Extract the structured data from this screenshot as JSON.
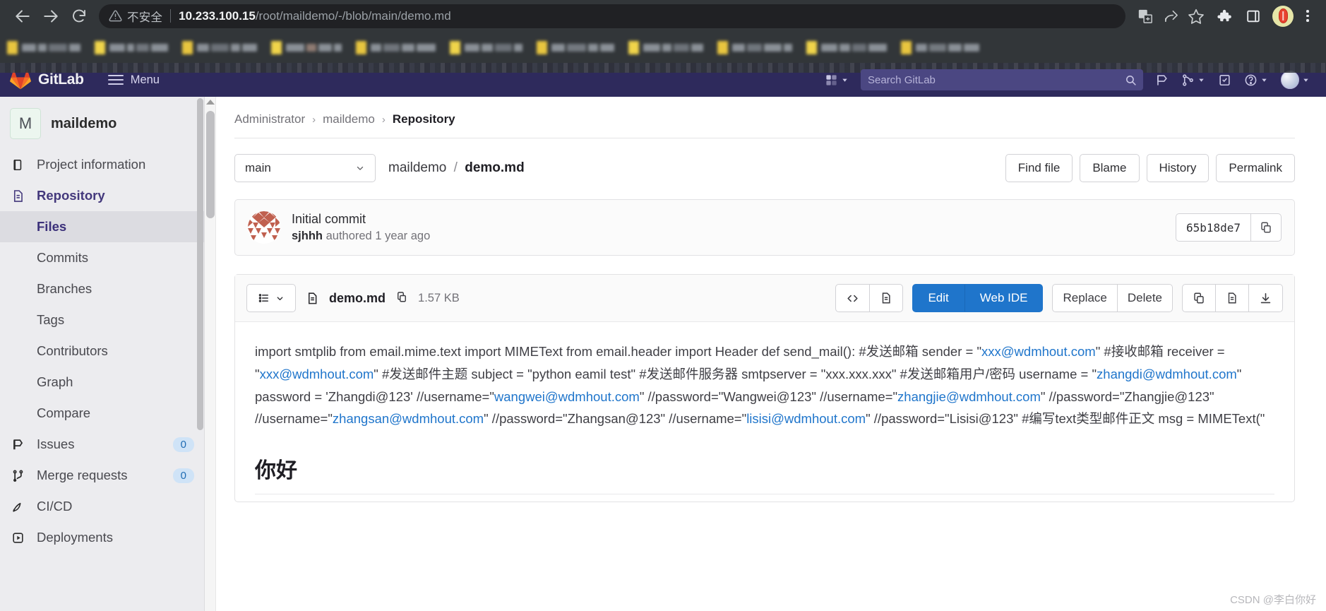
{
  "browser": {
    "back_icon": "back-arrow-icon",
    "forward_icon": "forward-arrow-icon",
    "reload_icon": "reload-icon",
    "security_label": "不安全",
    "url_bold": "10.233.100.15",
    "url_rest": "/root/maildemo/-/blob/main/demo.md",
    "translate_icon": "translate-icon",
    "share_icon": "share-icon",
    "bookmark_icon": "star-icon",
    "extensions_icon": "puzzle-icon",
    "sidepanel_icon": "side-panel-icon",
    "profile_icon": "profile-avatar-icon",
    "menu_icon": "three-dot-menu-icon"
  },
  "gitlab_nav": {
    "wordmark": "GitLab",
    "menu_label": "Menu",
    "search_placeholder": "Search GitLab",
    "icons": [
      "create-new-icon",
      "chevron-down-icon",
      "issues-icon",
      "merge-requests-icon",
      "todos-icon",
      "help-icon",
      "user-avatar-icon"
    ]
  },
  "sidebar": {
    "project_initial": "M",
    "project_name": "maildemo",
    "items": [
      {
        "label": "Project information",
        "icon": "project-info-icon",
        "active": false
      },
      {
        "label": "Repository",
        "icon": "repository-icon",
        "active": true
      }
    ],
    "sub_items": [
      {
        "label": "Files",
        "current": true
      },
      {
        "label": "Commits",
        "current": false
      },
      {
        "label": "Branches",
        "current": false
      },
      {
        "label": "Tags",
        "current": false
      },
      {
        "label": "Contributors",
        "current": false
      },
      {
        "label": "Graph",
        "current": false
      },
      {
        "label": "Compare",
        "current": false
      }
    ],
    "lower_items": [
      {
        "label": "Issues",
        "icon": "issues-icon",
        "badge": "0"
      },
      {
        "label": "Merge requests",
        "icon": "merge-request-icon",
        "badge": "0"
      },
      {
        "label": "CI/CD",
        "icon": "rocket-icon",
        "badge": ""
      },
      {
        "label": "Deployments",
        "icon": "deployments-icon",
        "badge": ""
      }
    ]
  },
  "breadcrumb": {
    "items": [
      "Administrator",
      "maildemo",
      "Repository"
    ],
    "separator": "›"
  },
  "file_topbar": {
    "branch": "main",
    "path_root": "maildemo",
    "path_sep": "/",
    "path_file": "demo.md",
    "buttons": [
      "Find file",
      "Blame",
      "History",
      "Permalink"
    ]
  },
  "commit": {
    "title": "Initial commit",
    "author": "sjhhh",
    "meta_suffix": "authored 1 year ago",
    "sha": "65b18de7",
    "copy_icon": "copy-icon",
    "avatar_icon": "identicon-avatar"
  },
  "blob": {
    "list_icon": "bullet-list-icon",
    "chevron_icon": "chevron-down-icon",
    "filename": "demo.md",
    "copy_path_icon": "copy-path-icon",
    "size": "1.57 KB",
    "view_source_icon": "code-brackets-icon",
    "view_rendered_icon": "document-icon",
    "edit_label": "Edit",
    "web_ide_label": "Web IDE",
    "replace_label": "Replace",
    "delete_label": "Delete",
    "copy_contents_icon": "copy-contents-icon",
    "open_raw_icon": "open-raw-icon",
    "download_icon": "download-icon"
  },
  "content": {
    "heading": "你好",
    "paragraph_parts": [
      {
        "t": "text",
        "v": "import smtplib from email.mime.text import MIMEText from email.header import Header def send_mail(): #发送邮箱 sender = \""
      },
      {
        "t": "link",
        "v": "xxx@wdmhout.com"
      },
      {
        "t": "text",
        "v": "\" #接收邮箱 receiver = \""
      },
      {
        "t": "link",
        "v": "xxx@wdmhout.com"
      },
      {
        "t": "text",
        "v": "\" #发送邮件主题 subject = \"python eamil test\" #发送邮件服务器 smtpserver = \"xxx.xxx.xxx\" #发送邮箱用户/密码 username = \""
      },
      {
        "t": "link",
        "v": "zhangdi@wdmhout.com"
      },
      {
        "t": "text",
        "v": "\" password = 'Zhangdi@123' //username=\""
      },
      {
        "t": "link",
        "v": "wangwei@wdmhout.com"
      },
      {
        "t": "text",
        "v": "\" //password=\"Wangwei@123\" //username=\""
      },
      {
        "t": "link",
        "v": "zhangjie@wdmhout.com"
      },
      {
        "t": "text",
        "v": "\" //password=\"Zhangjie@123\" //username=\""
      },
      {
        "t": "link",
        "v": "zhangsan@wdmhout.com"
      },
      {
        "t": "text",
        "v": "\" //password=\"Zhangsan@123\" //username=\""
      },
      {
        "t": "link",
        "v": "lisisi@wdmhout.com"
      },
      {
        "t": "text",
        "v": "\" //password=\"Lisisi@123\" #编写text类型邮件正文 msg = MIMEText(\""
      }
    ]
  },
  "watermark": "CSDN @李白你好",
  "colors": {
    "gitlab_nav_bg": "#2e2a5c",
    "primary_button": "#1f75cb",
    "link": "#1f75cb",
    "sidebar_bg": "#ececef",
    "active_sub_bg": "#dcdce1",
    "chrome_bg": "#323639",
    "omnibox_bg": "#202124"
  }
}
